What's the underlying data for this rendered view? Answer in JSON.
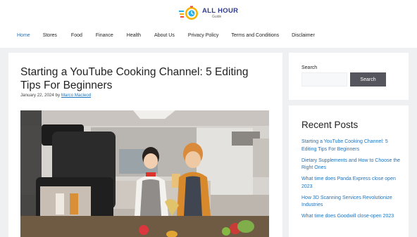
{
  "brand": {
    "title": "ALL HOUR",
    "subtitle": "Guide"
  },
  "nav": [
    {
      "label": "Home",
      "active": true
    },
    {
      "label": "Stores"
    },
    {
      "label": "Food"
    },
    {
      "label": "Finance"
    },
    {
      "label": "Health"
    },
    {
      "label": "About Us"
    },
    {
      "label": "Privacy Policy"
    },
    {
      "label": "Terms and Conditions"
    },
    {
      "label": "Disclaimer"
    }
  ],
  "post": {
    "title": "Starting a YouTube Cooking Channel: 5 Editing Tips For Beginners",
    "date": "January 22, 2024",
    "by": "by",
    "author": "Marco Macleod"
  },
  "search": {
    "label": "Search",
    "placeholder": "",
    "button": "Search"
  },
  "recent": {
    "heading": "Recent Posts",
    "items": [
      "Starting a YouTube Cooking Channel: 5 Editing Tips For Beginners",
      "Dietary Supplements and How to Choose the Right Ones",
      "What time does Panda Express close open 2023",
      "How 3D Scanning Services Revolutionize Industries",
      "What time does Goodwill close-open 2023"
    ]
  },
  "colors": {
    "link": "#1e73be",
    "brand": "#2f3b8f",
    "button": "#55555e"
  }
}
